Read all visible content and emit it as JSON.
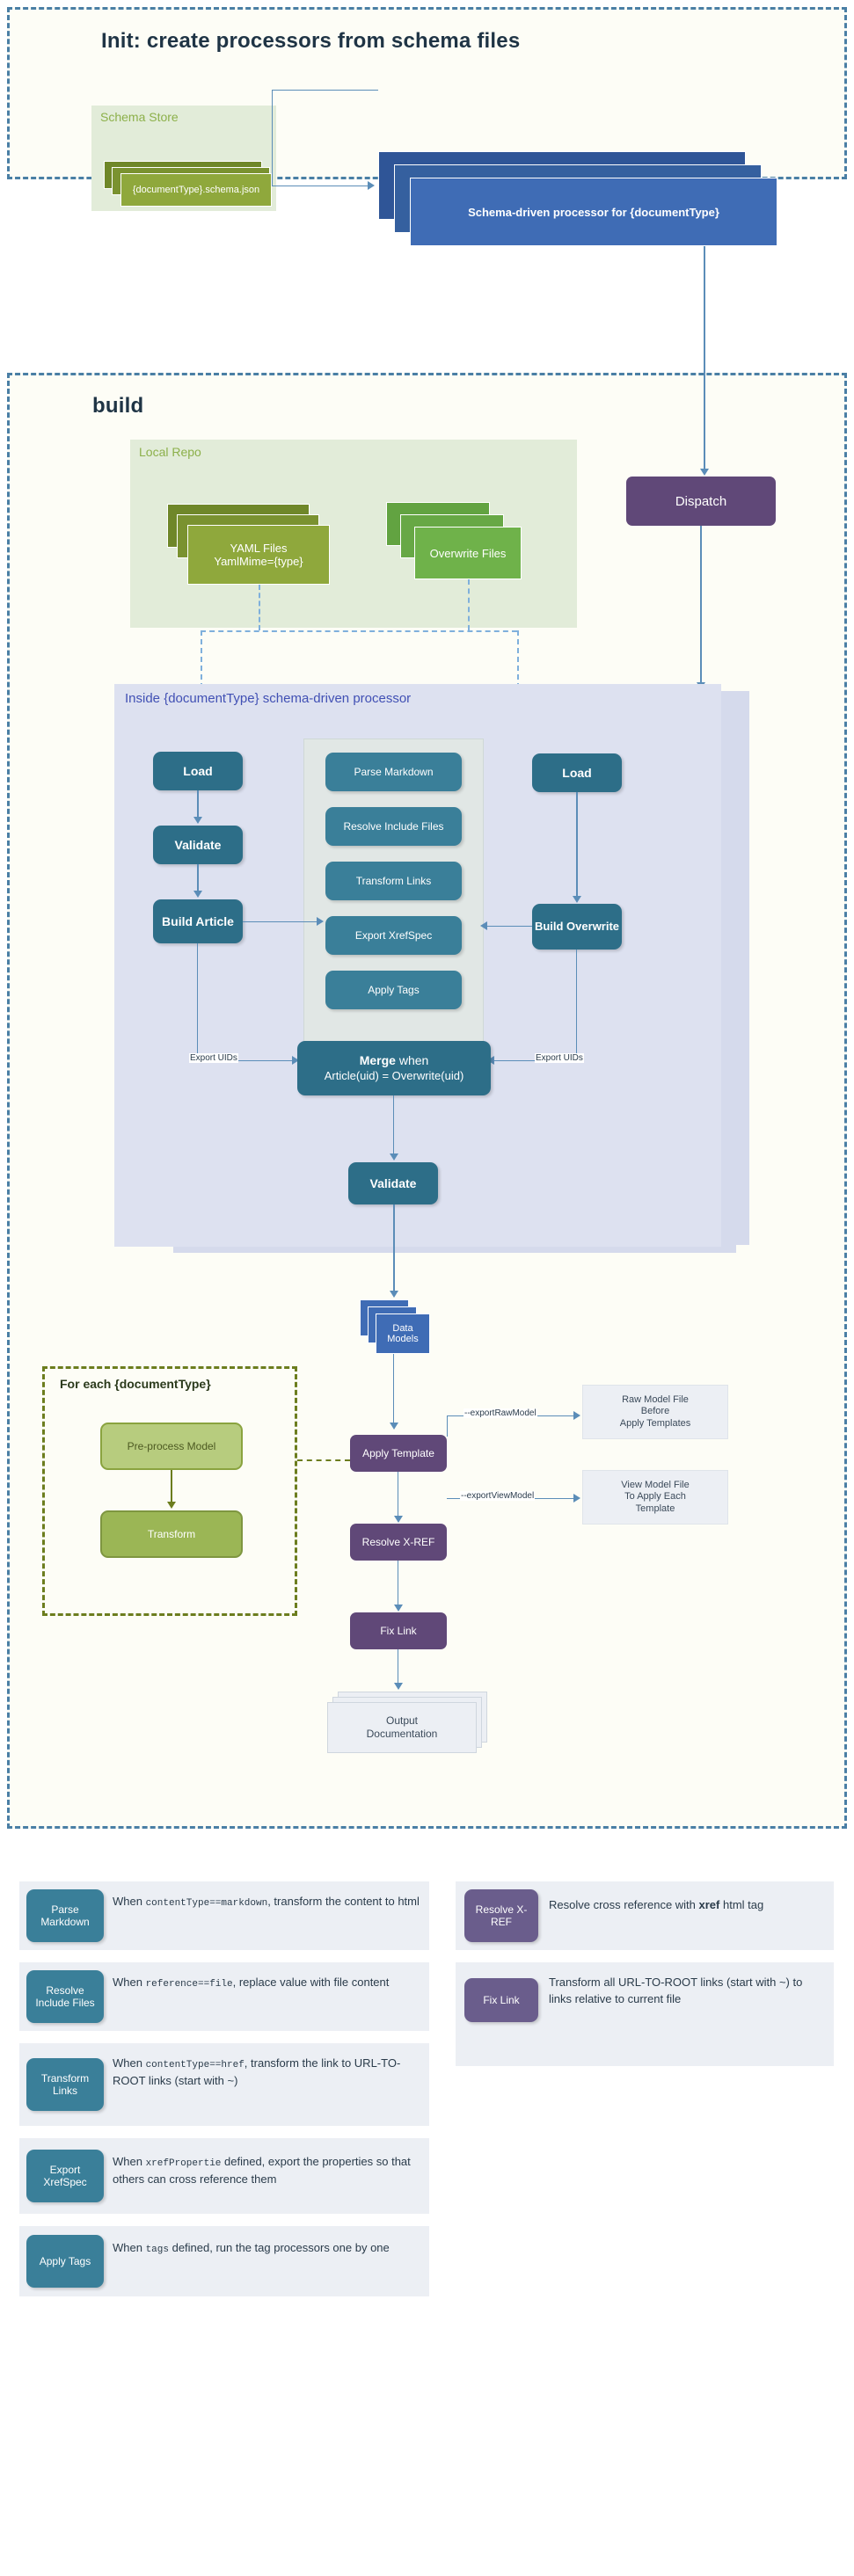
{
  "init": {
    "title": "Init: create processors from schema files",
    "schema_store": {
      "title": "Schema Store",
      "file_label": "{documentType}.schema.json"
    },
    "processor_label": "Schema-driven processor for {documentType}"
  },
  "build": {
    "title": "build",
    "local_repo": {
      "title": "Local Repo",
      "yaml_label_line1": "YAML Files",
      "yaml_label_line2": "YamlMime={type}",
      "overwrite_label": "Overwrite Files"
    },
    "dispatch_label": "Dispatch",
    "inner": {
      "title": "Inside {documentType} schema-driven processor",
      "left_nodes": [
        "Load",
        "Validate",
        "Build Article"
      ],
      "right_nodes": [
        "Load",
        "Build Overwrite"
      ],
      "plugin_nodes": [
        "Parse Markdown",
        "Resolve Include Files",
        "Transform Links",
        "Export XrefSpec",
        "Apply Tags"
      ],
      "merge_bold": "Merge",
      "merge_rest": " when",
      "merge_line2": "Article(uid) = Overwrite(uid)",
      "validate_label": "Validate",
      "edge_label_left": "Export UIDs",
      "edge_label_right": "Export UIDs"
    },
    "data_models_line1": "Data",
    "data_models_line2": "Models",
    "foreach": {
      "title": "For each {documentType}",
      "preprocess_label": "Pre-process Model",
      "transform_label": "Transform"
    },
    "apply_template_label": "Apply Template",
    "resolve_xref_label": "Resolve X-REF",
    "fix_link_label": "Fix Link",
    "output_line1": "Output",
    "output_line2": "Documentation",
    "export_raw_edge": "--exportRawModel",
    "export_view_edge": "--exportViewModel",
    "raw_note": [
      "Raw Model File",
      "Before",
      "Apply Templates"
    ],
    "view_note": [
      "View Model File",
      "To Apply Each",
      "Template"
    ]
  },
  "legend": {
    "left": [
      {
        "chip_line1": "Parse",
        "chip_line2": "Markdown",
        "desc_parts": [
          {
            "t": "When ",
            "style": "plain"
          },
          {
            "t": "contentType==markdown",
            "style": "mono"
          },
          {
            "t": ", transform the content to html",
            "style": "plain"
          }
        ]
      },
      {
        "chip_line1": "Resolve",
        "chip_line2": "Include Files",
        "desc_parts": [
          {
            "t": "When ",
            "style": "plain"
          },
          {
            "t": "reference==file",
            "style": "mono"
          },
          {
            "t": ", replace value with file content",
            "style": "plain"
          }
        ]
      },
      {
        "chip_line1": "Transform",
        "chip_line2": "Links",
        "desc_parts": [
          {
            "t": "When ",
            "style": "plain"
          },
          {
            "t": "contentType==href",
            "style": "mono"
          },
          {
            "t": ", transform the link to URL-TO-ROOT links (start with ~)",
            "style": "plain"
          }
        ]
      },
      {
        "chip_line1": "Export",
        "chip_line2": "XrefSpec",
        "desc_parts": [
          {
            "t": "When ",
            "style": "plain"
          },
          {
            "t": "xrefPropertie",
            "style": "mono"
          },
          {
            "t": " defined, export the properties so that others can cross reference them",
            "style": "plain"
          }
        ]
      },
      {
        "chip_line1": "Apply Tags",
        "chip_line2": "",
        "desc_parts": [
          {
            "t": "When ",
            "style": "plain"
          },
          {
            "t": "tags",
            "style": "mono"
          },
          {
            "t": " defined, run the tag processors one by one",
            "style": "plain"
          }
        ]
      }
    ],
    "right": [
      {
        "chip_line1": "Resolve X-",
        "chip_line2": "REF",
        "desc_parts": [
          {
            "t": "Resolve cross reference with ",
            "style": "plain"
          },
          {
            "t": "xref",
            "style": "bold"
          },
          {
            "t": " html tag",
            "style": "plain"
          }
        ]
      },
      {
        "chip_line1": "Fix Link",
        "chip_line2": "",
        "desc_parts": [
          {
            "t": "Transform all URL-TO-ROOT links (start with ~) to links relative to current file",
            "style": "plain"
          }
        ]
      }
    ]
  },
  "colors": {
    "phase_border": "#4a7fa5",
    "repo_green": "#e2ecd9",
    "olive": "#8fa83c",
    "green": "#6fb24a",
    "blue": "#3f6cb5",
    "purple": "#604878",
    "teal": "#2d6e88",
    "lavender": "#dde1f0"
  }
}
